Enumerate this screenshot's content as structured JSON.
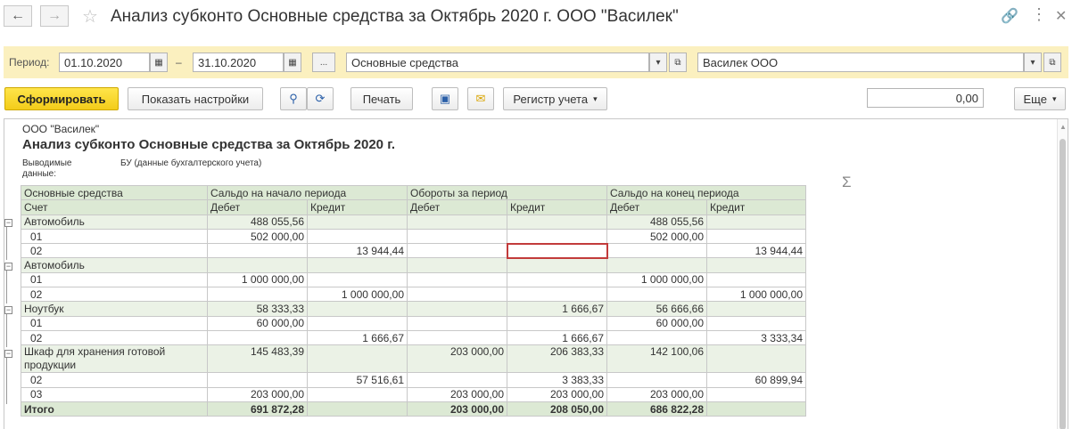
{
  "window": {
    "title": "Анализ субконто Основные средства за Октябрь 2020 г. ООО \"Василек\"",
    "back_icon": "arrow-left-icon",
    "forward_icon": "arrow-right-icon",
    "star_icon": "star-icon",
    "link_icon": "link-icon",
    "menu_icon": "more-vertical-icon",
    "maximize_icon": "maximize-icon",
    "close_icon": "close-icon"
  },
  "filters": {
    "period_label": "Период:",
    "date_from": "01.10.2020",
    "dash": "–",
    "date_to": "31.10.2020",
    "ellipsis": "...",
    "subkonto": "Основные средства",
    "organization": "Василек ООО"
  },
  "toolbar": {
    "generate": "Сформировать",
    "show_settings": "Показать настройки",
    "print": "Печать",
    "register": "Регистр учета",
    "sum_symbol": "Σ",
    "sum_value": "0,00",
    "more": "Еще"
  },
  "report": {
    "org": "ООО \"Василек\"",
    "title": "Анализ субконто Основные средства за Октябрь 2020 г.",
    "output_label": "Выводимые данные:",
    "output_value": "БУ (данные бухгалтерского учета)",
    "header1": [
      "Основные средства",
      "Сальдо на начало периода",
      "Обороты за период",
      "Сальдо на конец периода"
    ],
    "header2": [
      "Счет",
      "Дебет",
      "Кредит",
      "Дебет",
      "Кредит",
      "Дебет",
      "Кредит"
    ],
    "rows": [
      {
        "type": "group",
        "cells": [
          "Автомобиль",
          "488 055,56",
          "",
          "",
          "",
          "488 055,56",
          ""
        ]
      },
      {
        "type": "detail",
        "cells": [
          "01",
          "502 000,00",
          "",
          "",
          "",
          "502 000,00",
          ""
        ]
      },
      {
        "type": "detail",
        "cells": [
          "02",
          "",
          "13 944,44",
          "",
          "",
          "",
          "13 944,44"
        ]
      },
      {
        "type": "group",
        "cells": [
          "Автомобиль",
          "",
          "",
          "",
          "",
          "",
          ""
        ]
      },
      {
        "type": "detail",
        "cells": [
          "01",
          "1 000 000,00",
          "",
          "",
          "",
          "1 000 000,00",
          ""
        ]
      },
      {
        "type": "detail",
        "cells": [
          "02",
          "",
          "1 000 000,00",
          "",
          "",
          "",
          "1 000 000,00"
        ]
      },
      {
        "type": "group",
        "cells": [
          "Ноутбук",
          "58 333,33",
          "",
          "",
          "1 666,67",
          "56 666,66",
          ""
        ]
      },
      {
        "type": "detail",
        "cells": [
          "01",
          "60 000,00",
          "",
          "",
          "",
          "60 000,00",
          ""
        ]
      },
      {
        "type": "detail",
        "cells": [
          "02",
          "",
          "1 666,67",
          "",
          "1 666,67",
          "",
          "3 333,34"
        ]
      },
      {
        "type": "group2",
        "cells": [
          "Шкаф для хранения готовой продукции",
          "145 483,39",
          "",
          "203 000,00",
          "206 383,33",
          "142 100,06",
          ""
        ]
      },
      {
        "type": "detail",
        "cells": [
          "02",
          "",
          "57 516,61",
          "",
          "3 383,33",
          "",
          "60 899,94"
        ]
      },
      {
        "type": "detail",
        "cells": [
          "03",
          "203 000,00",
          "",
          "203 000,00",
          "203 000,00",
          "203 000,00",
          ""
        ]
      }
    ],
    "total": [
      "Итого",
      "691 872,28",
      "",
      "203 000,00",
      "208 050,00",
      "686 822,28",
      ""
    ]
  }
}
